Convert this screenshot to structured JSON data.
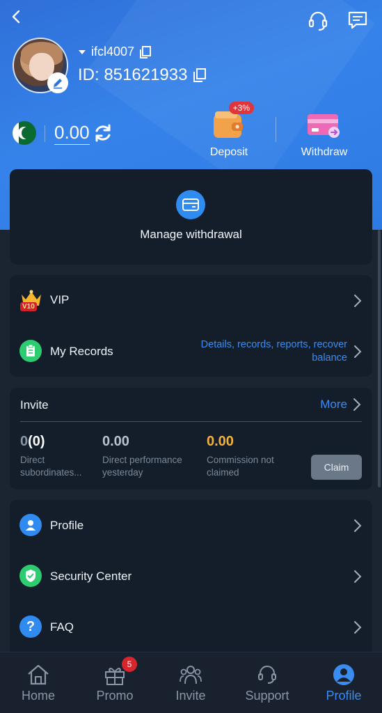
{
  "header": {
    "username": "ifcl4007",
    "id_label": "ID: 851621933",
    "balance": "0.00"
  },
  "actions": {
    "deposit_label": "Deposit",
    "deposit_bonus": "+3%",
    "withdraw_label": "Withdraw"
  },
  "manage": {
    "label": "Manage withdrawal"
  },
  "menu1": {
    "vip_label": "VIP",
    "vip_level": "V10",
    "records_label": "My Records",
    "records_desc_line1": "Details, records, reports, recover",
    "records_desc_line2": "balance"
  },
  "invite": {
    "title": "Invite",
    "more_label": "More",
    "stats": [
      {
        "value_main": "0",
        "value_paren": "(0)",
        "label_line1": "Direct",
        "label_line2": "subordinates..."
      },
      {
        "value_main": "0.00",
        "label_line1": "Direct performance",
        "label_line2": "yesterday"
      },
      {
        "value_main": "0.00",
        "label_line1": "Commission not",
        "label_line2": "claimed"
      }
    ],
    "claim_label": "Claim"
  },
  "menu2": {
    "profile_label": "Profile",
    "security_label": "Security Center",
    "faq_label": "FAQ"
  },
  "nav": {
    "home": "Home",
    "promo": "Promo",
    "promo_badge": "5",
    "invite": "Invite",
    "support": "Support",
    "profile": "Profile"
  },
  "colors": {
    "accent": "#3a8cf0",
    "gold": "#f2b23a",
    "badge_red": "#d8262f"
  }
}
